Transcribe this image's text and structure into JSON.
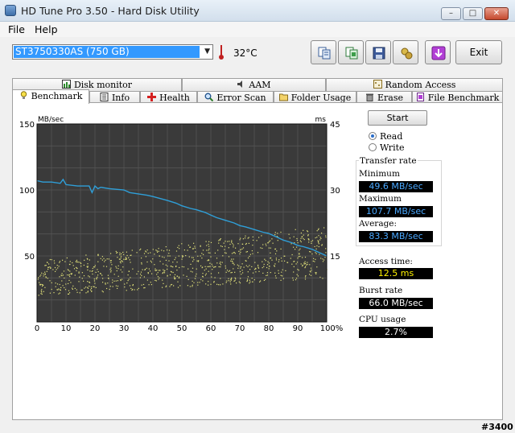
{
  "window": {
    "title": "HD Tune Pro 3.50 - Hard Disk Utility"
  },
  "menu": [
    "File",
    "Help"
  ],
  "toolbar": {
    "drive": "ST3750330AS (750 GB)",
    "temperature": "32°C",
    "exit_label": "Exit",
    "buttons": [
      "copy-text-icon",
      "copy-screenshot-icon",
      "save-icon",
      "options-icon",
      "down-arrow-icon"
    ]
  },
  "tabs_top": [
    {
      "label": "Disk monitor",
      "icon": "disk-monitor-icon"
    },
    {
      "label": "AAM",
      "icon": "speaker-icon"
    },
    {
      "label": "Random Access",
      "icon": "random-access-icon"
    }
  ],
  "tabs_bottom": [
    {
      "label": "Benchmark",
      "icon": "bulb-icon",
      "active": true
    },
    {
      "label": "Info",
      "icon": "info-icon"
    },
    {
      "label": "Health",
      "icon": "health-cross-icon"
    },
    {
      "label": "Error Scan",
      "icon": "magnifier-icon"
    },
    {
      "label": "Folder Usage",
      "icon": "folder-icon"
    },
    {
      "label": "Erase",
      "icon": "trash-icon"
    },
    {
      "label": "File Benchmark",
      "icon": "file-icon"
    }
  ],
  "controls": {
    "start_label": "Start",
    "read_label": "Read",
    "write_label": "Write",
    "mode": "Read"
  },
  "results": {
    "transfer_rate_label": "Transfer rate",
    "minimum_label": "Minimum",
    "minimum": "49.6 MB/sec",
    "maximum_label": "Maximum",
    "maximum": "107.7 MB/sec",
    "average_label": "Average:",
    "average": "83.3 MB/sec",
    "access_time_label": "Access time:",
    "access_time": "12.5 ms",
    "burst_rate_label": "Burst rate",
    "burst_rate": "66.0 MB/sec",
    "cpu_usage_label": "CPU usage",
    "cpu_usage": "2.7%"
  },
  "watermark": "#3400",
  "chart_data": {
    "type": "line",
    "y_left_unit": "MB/sec",
    "y_right_unit": "ms",
    "ylim_left": [
      0,
      150
    ],
    "ylim_right": [
      0,
      45
    ],
    "xlim": [
      0,
      100
    ],
    "x_ticks": [
      "0",
      "10",
      "20",
      "30",
      "40",
      "50",
      "60",
      "70",
      "80",
      "90",
      "100%"
    ],
    "y_left_ticks": [
      "150",
      "100",
      "50"
    ],
    "y_right_ticks": [
      "45",
      "30",
      "15"
    ],
    "grid": true,
    "series": [
      {
        "type": "line",
        "color": "#2f9fd8",
        "x": [
          0,
          2,
          5,
          8,
          9,
          10,
          14,
          18,
          19,
          20,
          21,
          22,
          25,
          30,
          32,
          35,
          38,
          40,
          45,
          48,
          50,
          53,
          55,
          58,
          60,
          62,
          65,
          68,
          70,
          72,
          75,
          78,
          80,
          82,
          85,
          88,
          90,
          92,
          95,
          98,
          100
        ],
        "y": [
          107,
          106,
          106,
          105,
          108,
          104,
          103,
          103,
          98,
          103,
          101,
          102,
          101,
          100,
          98,
          97,
          96,
          95,
          92,
          90,
          88,
          86,
          85,
          83,
          81,
          79,
          77,
          75,
          73,
          72,
          70,
          68,
          67,
          65,
          62,
          60,
          58,
          57,
          55,
          52,
          50
        ]
      },
      {
        "type": "scatter",
        "color": "#e2e27a",
        "x_range": [
          0,
          100
        ],
        "y_right_range_start": [
          6,
          14
        ],
        "y_right_range_end": [
          10,
          22
        ]
      }
    ]
  }
}
